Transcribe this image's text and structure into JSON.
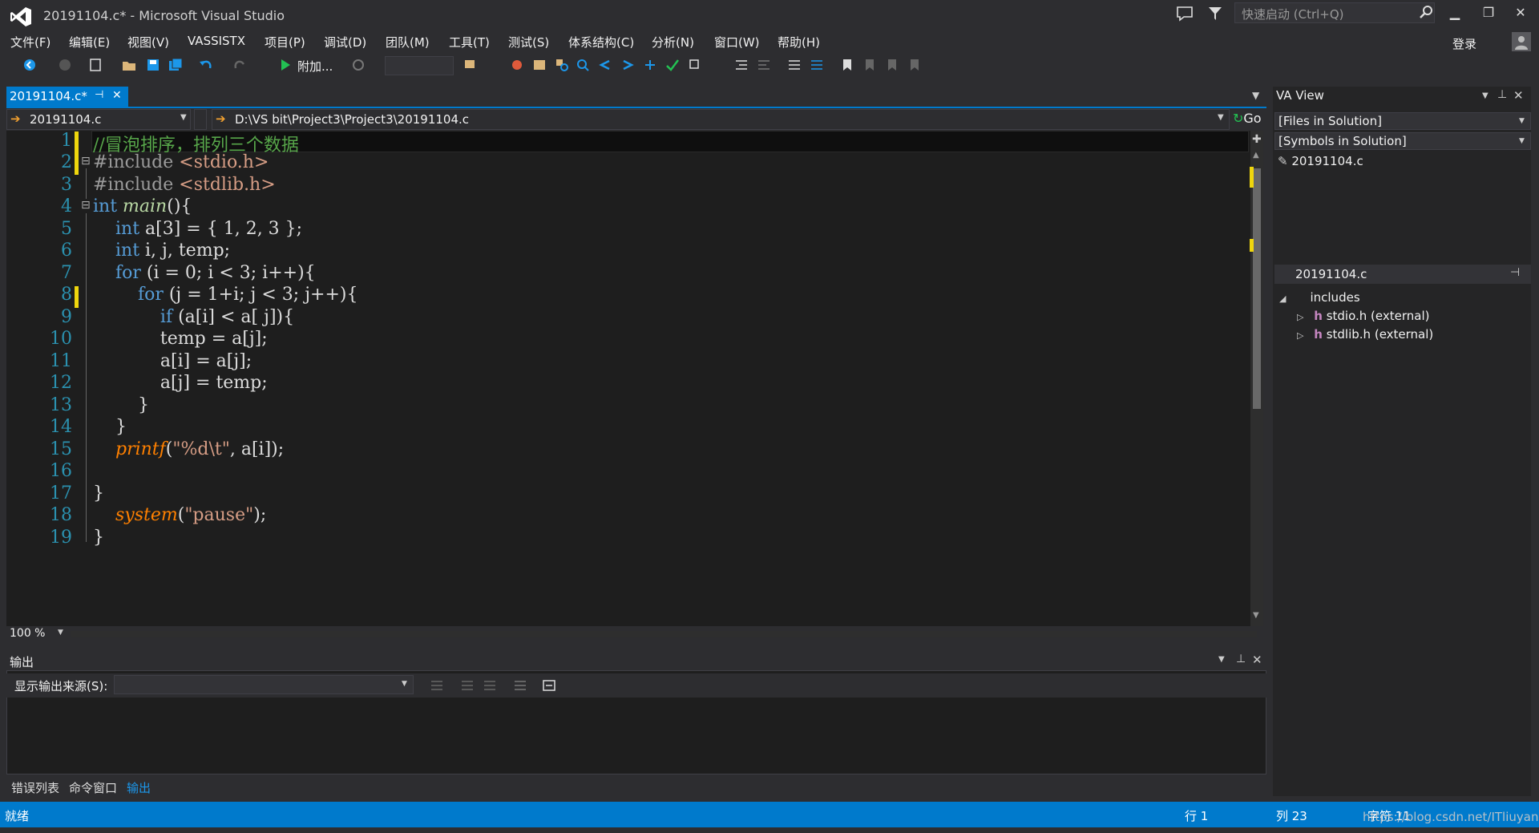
{
  "window": {
    "title": "20191104.c* - Microsoft Visual Studio",
    "quick_launch_placeholder": "快速启动 (Ctrl+Q)",
    "login": "登录",
    "minimize": "▁",
    "restore": "❐",
    "close": "✕"
  },
  "menu": [
    "文件(F)",
    "编辑(E)",
    "视图(V)",
    "VASSISTX",
    "项目(P)",
    "调试(D)",
    "团队(M)",
    "工具(T)",
    "测试(S)",
    "体系结构(C)",
    "分析(N)",
    "窗口(W)",
    "帮助(H)"
  ],
  "toolbar": {
    "attach_label": "附加..."
  },
  "tab": {
    "label": "20191104.c*",
    "pin": "⊣",
    "close": "✕"
  },
  "nav": {
    "file": "20191104.c",
    "path": "D:\\VS bit\\Project3\\Project3\\20191104.c",
    "go": "Go"
  },
  "editor": {
    "line_numbers": [
      "1",
      "2",
      "3",
      "4",
      "5",
      "6",
      "7",
      "8",
      "9",
      "10",
      "11",
      "12",
      "13",
      "14",
      "15",
      "16",
      "17",
      "18",
      "19"
    ],
    "zoom": "100 %"
  },
  "output": {
    "title": "输出",
    "source_label": "显示输出来源(S):",
    "source_value": ""
  },
  "bottom_tabs": [
    "错误列表",
    "命令窗口",
    "输出"
  ],
  "va_view": {
    "title": "VA View",
    "files_combo": "[Files in Solution]",
    "symbols_combo": "[Symbols in Solution]",
    "file_item": "20191104.c",
    "tree_header": "20191104.c",
    "tree_root": "includes",
    "tree_items": [
      "stdio.h (external)",
      "stdlib.h (external)"
    ]
  },
  "status": {
    "ready": "就绪",
    "line": "行 1",
    "col": "列 23",
    "char": "字符 11",
    "watermark": "https://blog.csdn.net/ITliuyang"
  },
  "colors": {
    "accent": "#007acc",
    "editor_bg": "#1e1e1e",
    "chrome_bg": "#2d2d30",
    "keyword": "#569cd6",
    "comment": "#57a64a",
    "line_number": "#2b91af",
    "change_marker": "#efd60d"
  }
}
